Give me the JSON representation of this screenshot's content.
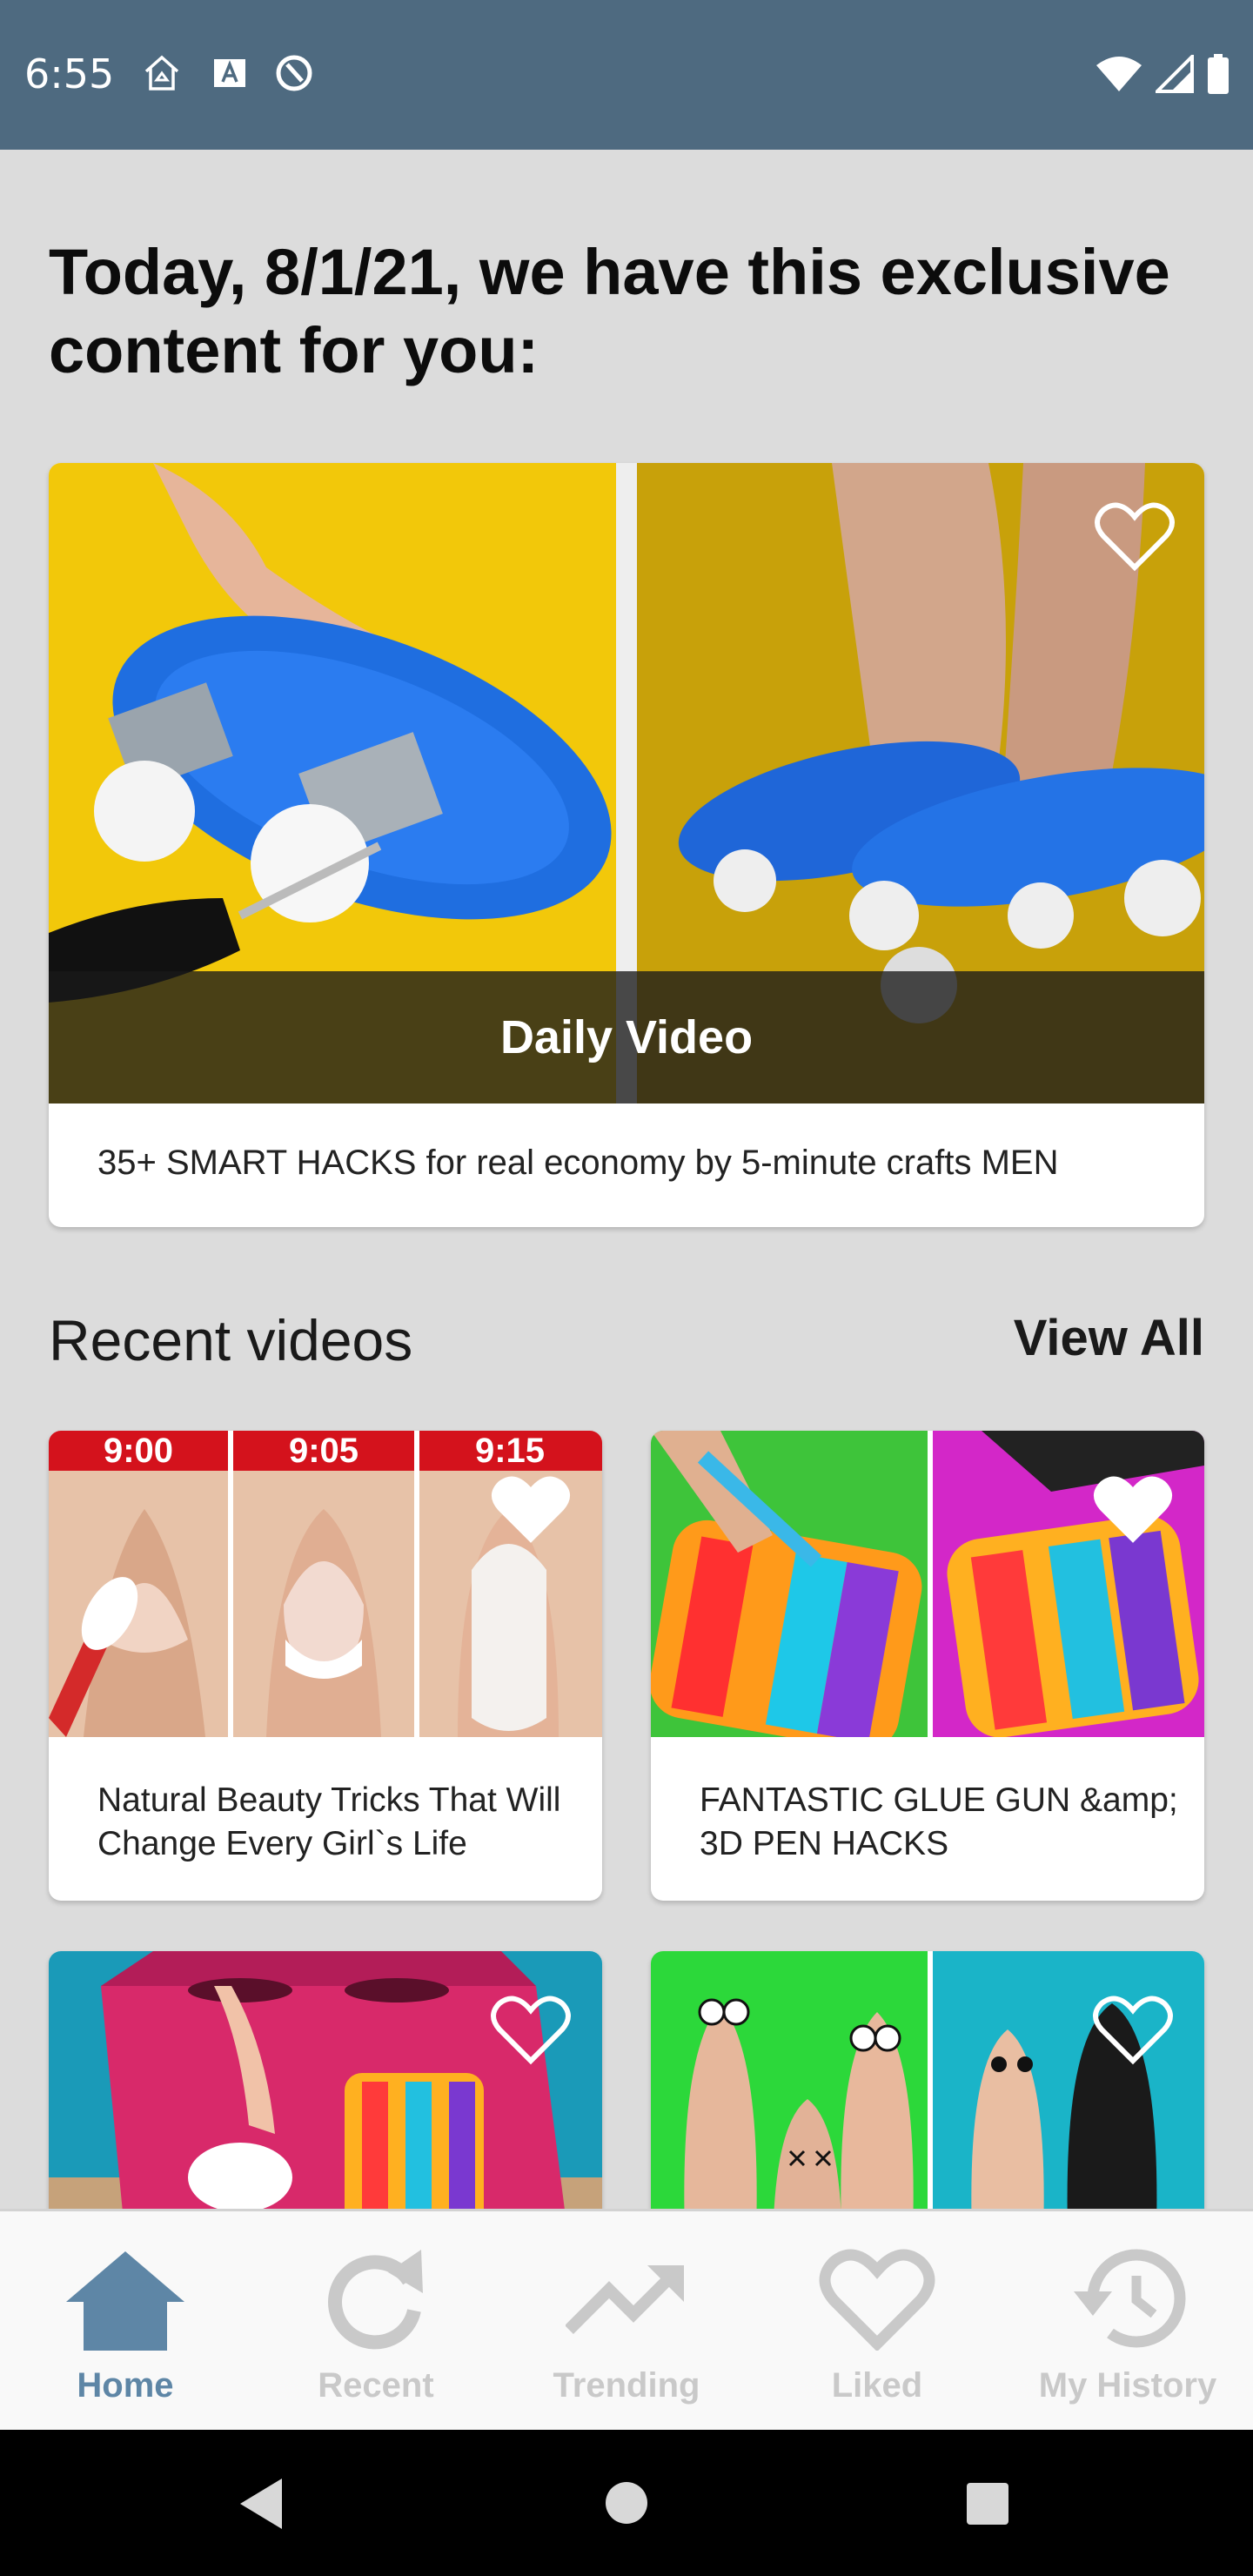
{
  "status_bar": {
    "time": "6:55",
    "icons_left": [
      "home-notification-icon",
      "app-a-icon",
      "blocked-notification-icon"
    ],
    "icons_right": [
      "wifi-icon",
      "signal-icon",
      "battery-icon"
    ]
  },
  "headline": "Today, 8/1/21, we have this exclusive content for you:",
  "featured": {
    "badge": "Daily Video",
    "title": "35+ SMART HACKS for real economy by 5-minute crafts MEN",
    "liked": false
  },
  "recent": {
    "title": "Recent videos",
    "view_all": "View All",
    "items": [
      {
        "title": "Natural Beauty Tricks That Will Change Every Girl`s Life",
        "liked": true,
        "times": [
          "9:00",
          "9:05",
          "9:15"
        ]
      },
      {
        "title": "FANTASTIC GLUE GUN &amp; 3D PEN HACKS",
        "liked": true
      },
      {
        "title": "",
        "liked": false
      },
      {
        "title": "",
        "liked": false
      }
    ]
  },
  "nav": {
    "items": [
      {
        "label": "Home",
        "icon": "home-icon",
        "active": true
      },
      {
        "label": "Recent",
        "icon": "refresh-icon",
        "active": false
      },
      {
        "label": "Trending",
        "icon": "trending-icon",
        "active": false
      },
      {
        "label": "Liked",
        "icon": "heart-icon",
        "active": false
      },
      {
        "label": "My History",
        "icon": "history-icon",
        "active": false
      }
    ]
  },
  "colors": {
    "status_bar": "#4e6a80",
    "nav_active": "#5e86a6",
    "nav_inactive": "#c9c9c9"
  }
}
